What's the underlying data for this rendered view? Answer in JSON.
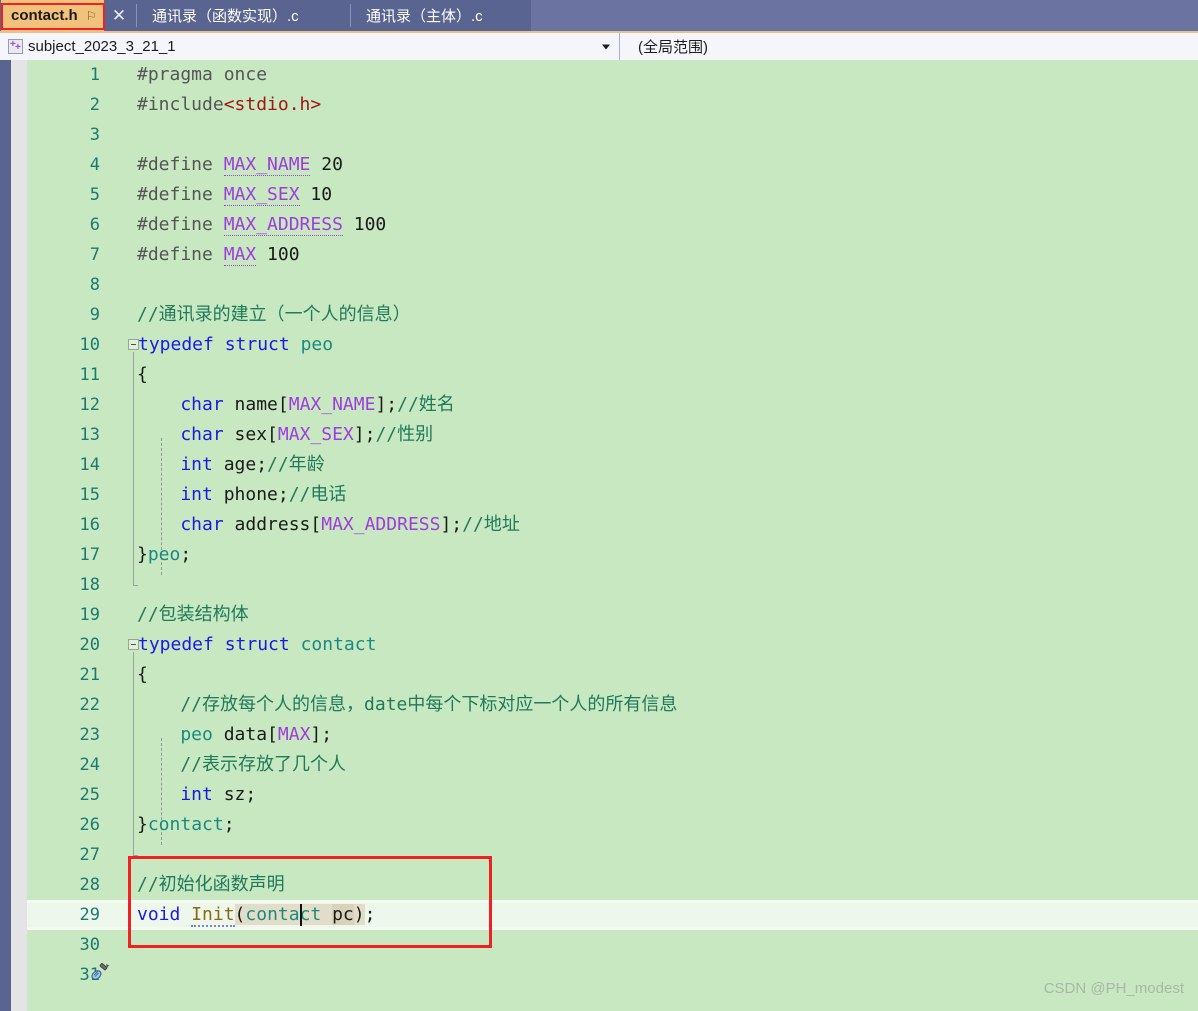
{
  "window": {
    "accent_orange": "#f2c27c",
    "accent_blue": "#5a6490",
    "editor_bg": "#c8e8c2",
    "highlight_red": "#ee2222"
  },
  "tabs": [
    {
      "label": "contact.h",
      "active": true,
      "pin_icon": "pin-icon",
      "pin_glyph": "⚐",
      "highlighted": true
    },
    {
      "label": "通讯录（函数实现）.c",
      "active": false
    },
    {
      "label": "通讯录（主体）.c",
      "active": false
    }
  ],
  "tab_close_glyph": "✕",
  "navbar": {
    "project_icon": "cpp-project-icon",
    "scope_value": "subject_2023_3_21_1",
    "member_value": "(全局范围)",
    "dropdown_glyph": "▼"
  },
  "editor": {
    "language": "c",
    "caret": {
      "line": 29,
      "column": 22
    },
    "current_line": 29,
    "watermark": "CSDN @PH_modest",
    "gutter_icon_line29": "quick-action-screwdriver-icon",
    "lines": [
      {
        "n": 1,
        "code": "#pragma once"
      },
      {
        "n": 2,
        "code": "#include<stdio.h>"
      },
      {
        "n": 3,
        "code": ""
      },
      {
        "n": 4,
        "code": "#define MAX_NAME 20"
      },
      {
        "n": 5,
        "code": "#define MAX_SEX 10"
      },
      {
        "n": 6,
        "code": "#define MAX_ADDRESS 100"
      },
      {
        "n": 7,
        "code": "#define MAX 100"
      },
      {
        "n": 8,
        "code": ""
      },
      {
        "n": 9,
        "code": "//通讯录的建立（一个人的信息）"
      },
      {
        "n": 10,
        "code": "typedef struct peo"
      },
      {
        "n": 11,
        "code": "{"
      },
      {
        "n": 12,
        "code": "    char name[MAX_NAME];//姓名"
      },
      {
        "n": 13,
        "code": "    char sex[MAX_SEX];//性别"
      },
      {
        "n": 14,
        "code": "    int age;//年龄"
      },
      {
        "n": 15,
        "code": "    int phone;//电话"
      },
      {
        "n": 16,
        "code": "    char address[MAX_ADDRESS];//地址"
      },
      {
        "n": 17,
        "code": "}peo;"
      },
      {
        "n": 18,
        "code": ""
      },
      {
        "n": 19,
        "code": "//包装结构体"
      },
      {
        "n": 20,
        "code": "typedef struct contact"
      },
      {
        "n": 21,
        "code": "{"
      },
      {
        "n": 22,
        "code": "    //存放每个人的信息，date中每个下标对应一个人的所有信息"
      },
      {
        "n": 23,
        "code": "    peo data[MAX];"
      },
      {
        "n": 24,
        "code": "    //表示存放了几个人"
      },
      {
        "n": 25,
        "code": "    int sz;"
      },
      {
        "n": 26,
        "code": "}contact;"
      },
      {
        "n": 27,
        "code": ""
      },
      {
        "n": 28,
        "code": "//初始化函数声明"
      },
      {
        "n": 29,
        "code": "void Init(contact pc);"
      },
      {
        "n": 30,
        "code": ""
      },
      {
        "n": 31,
        "code": ""
      }
    ]
  },
  "annotations": {
    "tab_box": "red-rectangle-around-contact-h-tab",
    "code_box": "red-rectangle-around-lines-28-29"
  }
}
